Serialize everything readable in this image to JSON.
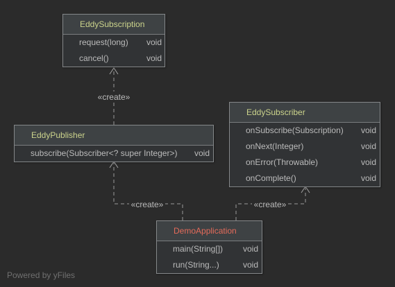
{
  "diagram": {
    "classes": [
      {
        "title": "EddySubscription",
        "methods": [
          {
            "signature": "request(long)",
            "return_type": "void"
          },
          {
            "signature": "cancel()",
            "return_type": "void"
          }
        ]
      },
      {
        "title": "EddyPublisher",
        "methods": [
          {
            "signature": "subscribe(Subscriber<? super Integer>)",
            "return_type": "void"
          }
        ]
      },
      {
        "title": "EddySubscriber",
        "methods": [
          {
            "signature": "onSubscribe(Subscription)",
            "return_type": "void"
          },
          {
            "signature": "onNext(Integer)",
            "return_type": "void"
          },
          {
            "signature": "onError(Throwable)",
            "return_type": "void"
          },
          {
            "signature": "onComplete()",
            "return_type": "void"
          }
        ]
      },
      {
        "title": "DemoApplication",
        "methods": [
          {
            "signature": "main(String[])",
            "return_type": "void"
          },
          {
            "signature": "run(String...)",
            "return_type": "void"
          }
        ]
      }
    ],
    "relations": [
      {
        "from": "EddyPublisher",
        "to": "EddySubscription",
        "label": "«create»"
      },
      {
        "from": "DemoApplication",
        "to": "EddyPublisher",
        "label": "«create»"
      },
      {
        "from": "DemoApplication",
        "to": "EddySubscriber",
        "label": "«create»"
      }
    ]
  },
  "footer": {
    "text": "Powered by yFiles"
  },
  "colors": {
    "background": "#2b2b2b",
    "class_title": "#ccd48c",
    "entry_class_title": "#e56b5a",
    "member_text": "#bbbbbb",
    "edge": "#9b9b9b",
    "node_border": "#85888a"
  }
}
